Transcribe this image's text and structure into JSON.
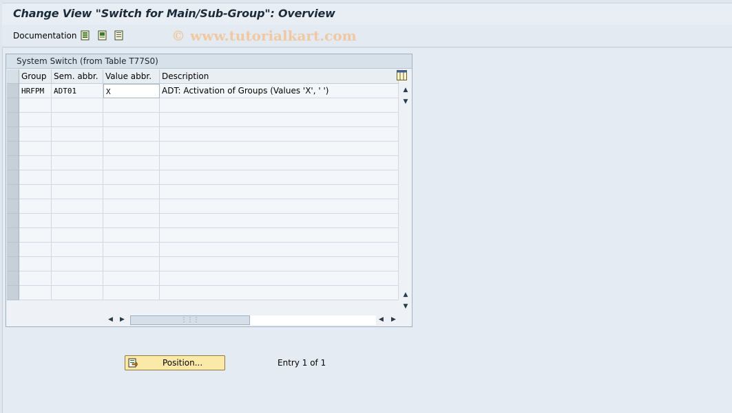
{
  "window": {
    "title": "Change View \"Switch for Main/Sub-Group\": Overview"
  },
  "toolbar": {
    "documentation_label": "Documentation",
    "watermark": "© www.tutorialkart.com"
  },
  "panel": {
    "title": "System Switch (from Table T77S0)"
  },
  "table": {
    "columns": [
      "Group",
      "Sem. abbr.",
      "Value abbr.",
      "Description"
    ],
    "rows": [
      {
        "group": "HRFPM",
        "sem_abbr": "ADT01",
        "value_abbr": "X",
        "description": "ADT: Activation of Groups (Values 'X', ' ')"
      }
    ],
    "empty_rows": 15
  },
  "footer": {
    "position_button_label": "Position...",
    "entry_text": "Entry 1 of 1"
  },
  "colors": {
    "accent_button": "#fbe9a8",
    "header_bg": "#e9eef3",
    "panel_title_bg": "#d7e1ea"
  }
}
